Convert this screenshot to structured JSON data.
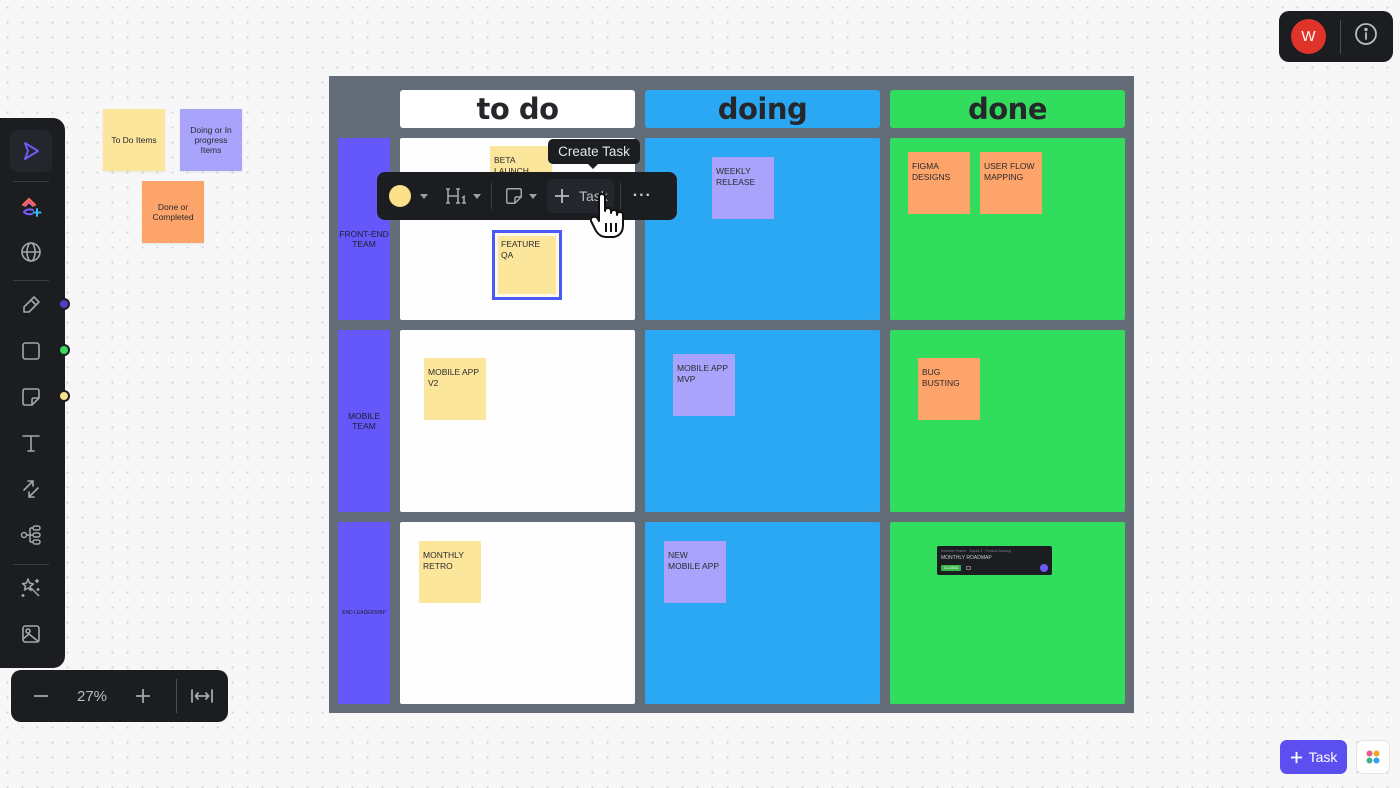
{
  "legend": [
    {
      "label": "To Do Items",
      "color": "#fbe69b"
    },
    {
      "label": "Doing or In progress Items",
      "color": "#a9a3fb"
    },
    {
      "label": "Done or Completed",
      "color": "#fda46b"
    }
  ],
  "left_toolbar": {
    "tools": [
      {
        "name": "select",
        "icon": "cursor-pointer-icon",
        "active": true
      },
      {
        "name": "clickup-ai",
        "icon": "clickup-add-icon"
      },
      {
        "name": "embed",
        "icon": "globe-icon"
      },
      {
        "name": "pen",
        "icon": "pen-icon",
        "color_dot": "#4b3ec9"
      },
      {
        "name": "shape",
        "icon": "square-icon",
        "color_dot": "#3bd660"
      },
      {
        "name": "sticky-note",
        "icon": "sticky-note-icon",
        "color_dot": "#f9df8e"
      },
      {
        "name": "text",
        "icon": "text-icon"
      },
      {
        "name": "connector",
        "icon": "connector-arrows-icon"
      },
      {
        "name": "mind-map",
        "icon": "mind-map-icon"
      },
      {
        "name": "ai-magic",
        "icon": "magic-wand-icon"
      },
      {
        "name": "image",
        "icon": "image-icon"
      }
    ]
  },
  "zoom": {
    "value": "27%",
    "minus": "−",
    "plus": "+"
  },
  "board": {
    "columns": [
      {
        "label": "to do",
        "color": "#ffffff"
      },
      {
        "label": "doing",
        "color": "#2aa8f4"
      },
      {
        "label": "done",
        "color": "#32dd5d"
      }
    ],
    "rows": [
      {
        "label": "FRONT-END TEAM"
      },
      {
        "label": "MOBILE TEAM"
      },
      {
        "label": "END LEADERSHIP"
      }
    ],
    "stickies": [
      {
        "text": "BETA LAUNCH",
        "row": 0,
        "col": 0,
        "color": "yellow"
      },
      {
        "text": "FEATURE QA",
        "row": 0,
        "col": 0,
        "color": "yellow",
        "selected": true
      },
      {
        "text": "WEEKLY RELEASE",
        "row": 0,
        "col": 1,
        "color": "purple"
      },
      {
        "text": "FIGMA DESIGNS",
        "row": 0,
        "col": 2,
        "color": "orange"
      },
      {
        "text": "USER FLOW MAPPING",
        "row": 0,
        "col": 2,
        "color": "orange"
      },
      {
        "text": "MOBILE APP V2",
        "row": 1,
        "col": 0,
        "color": "yellow"
      },
      {
        "text": "MOBILE APP MVP",
        "row": 1,
        "col": 1,
        "color": "purple"
      },
      {
        "text": "BUG BUSTING",
        "row": 1,
        "col": 2,
        "color": "orange"
      },
      {
        "text": "MONTHLY RETRO",
        "row": 2,
        "col": 0,
        "color": "yellow"
      },
      {
        "text": "NEW MOBILE APP",
        "row": 2,
        "col": 1,
        "color": "purple"
      }
    ],
    "task_card": {
      "breadcrumb": "Software Teams · Squad 1 · Product Backlog",
      "title": "MONTHLY ROADMAP",
      "status": "CLOSED",
      "status_color": "#3bb54a"
    }
  },
  "float_toolbar": {
    "color_swatch": "#fbe08a",
    "heading_label": "H1",
    "task_label": "Task",
    "tooltip": "Create Task",
    "more_label": "···"
  },
  "top_right": {
    "avatar_initial": "W"
  },
  "bottom_right": {
    "task_button_label": "Task"
  }
}
